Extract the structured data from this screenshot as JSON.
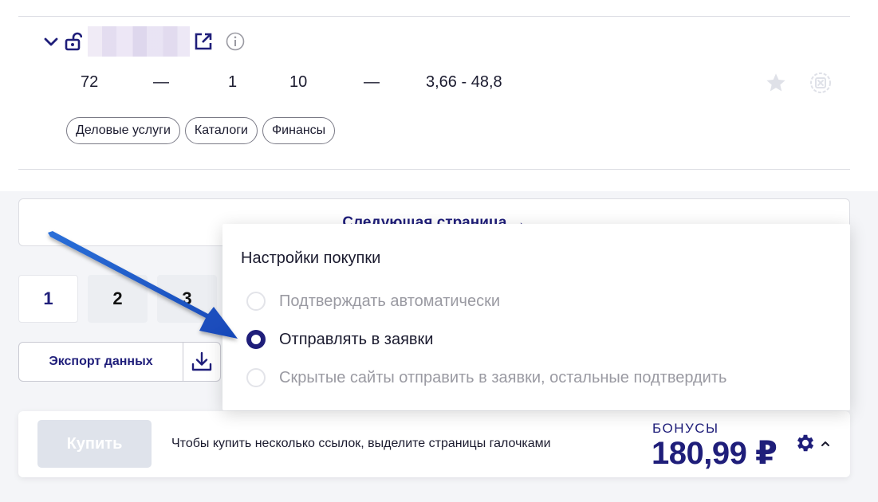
{
  "site_row": {
    "stats": [
      "72",
      "—",
      "1",
      "10",
      "—",
      "3,66 - 48,8"
    ],
    "tags": [
      "Деловые услуги",
      "Каталоги",
      "Финансы"
    ]
  },
  "next_page_label": "Следующая страница →",
  "pagination": [
    "1",
    "2",
    "3"
  ],
  "export_label": "Экспорт данных",
  "bottom_bar": {
    "buy_label": "Купить",
    "hint": "Чтобы купить несколько ссылок, выделите страницы галочками",
    "bonus_label": "БОНУСЫ",
    "bonus_value": "180,99 ₽"
  },
  "purchase_settings": {
    "title": "Настройки покупки",
    "options": [
      {
        "label": "Подтверждать автоматически",
        "selected": false
      },
      {
        "label": "Отправлять в заявки",
        "selected": true
      },
      {
        "label": "Скрытые сайты отправить в заявки, остальные подтвердить",
        "selected": false
      }
    ]
  },
  "colors": {
    "accent": "#1f1e7a",
    "arrow": "#1a56c4"
  },
  "icons": [
    "chevron-down-icon",
    "lock-open-icon",
    "external-link-icon",
    "info-icon",
    "star-icon",
    "hide-icon",
    "download-icon",
    "gear-icon",
    "caret-up-icon"
  ]
}
